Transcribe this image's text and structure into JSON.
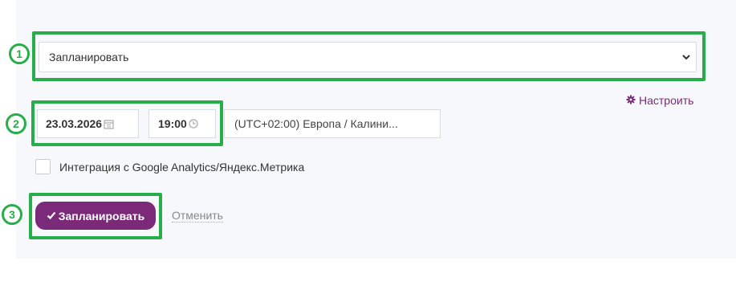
{
  "schedule": {
    "mode_select": {
      "value": "Запланировать"
    },
    "settings_label": "Настроить",
    "date": "23.03.2026",
    "time": "19:00",
    "timezone": "(UTC+02:00) Европа / Калини...",
    "analytics_label": "Интеграция с Google Analytics/Яндекс.Метрика",
    "submit_label": "Запланировать",
    "cancel_label": "Отменить"
  },
  "annotations": [
    "1",
    "2",
    "3"
  ],
  "colors": {
    "accent": "#7a2a78",
    "highlight": "#27ae4b",
    "panel_bg": "#f7f8fb"
  },
  "icons": [
    "chevron-down-icon",
    "gear-icon",
    "calendar-icon",
    "clock-icon",
    "checkmark-icon"
  ]
}
